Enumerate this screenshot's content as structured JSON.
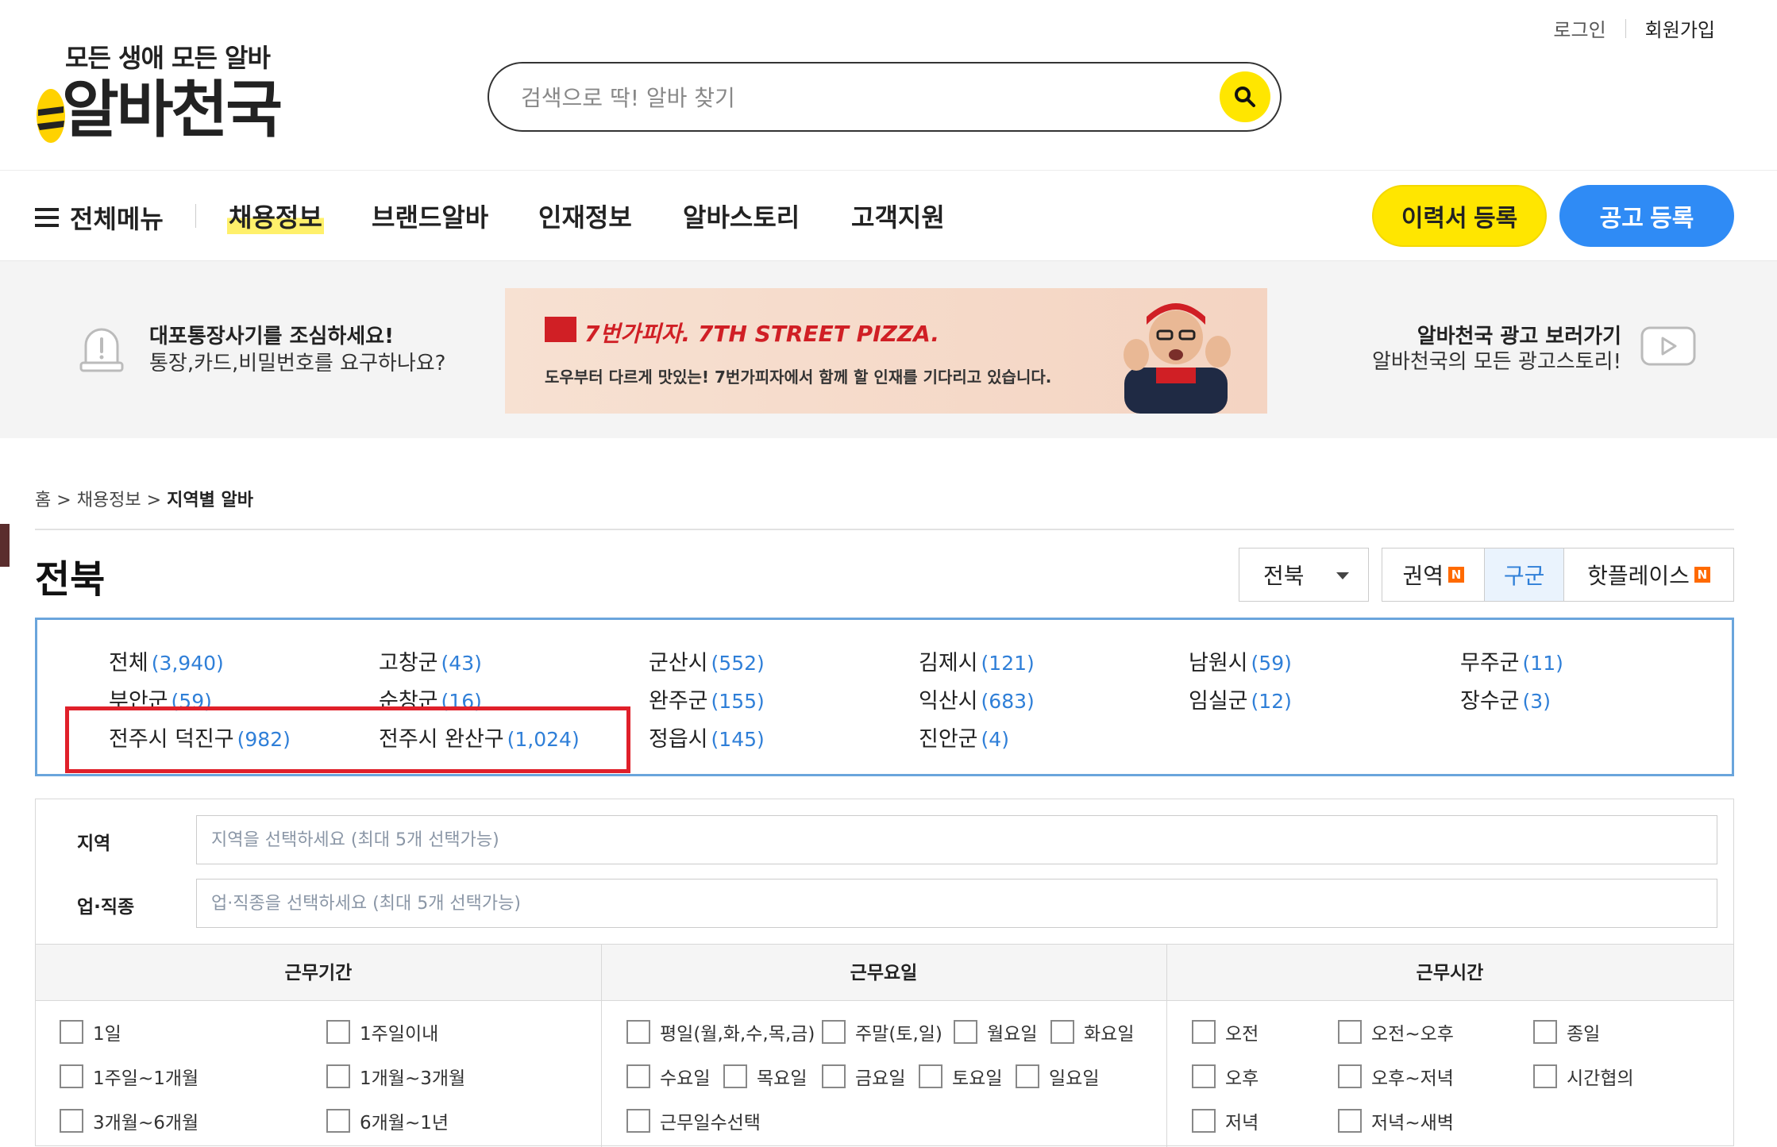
{
  "header": {
    "tagline": "모든 생애 모든 알바",
    "brand": "알바천국",
    "search_placeholder": "검색으로 딱! 알바 찾기",
    "login": "로그인",
    "join": "회원가입"
  },
  "nav": {
    "all_menu": "전체메뉴",
    "items": [
      "채용정보",
      "브랜드알바",
      "인재정보",
      "알바스토리",
      "고객지원"
    ],
    "resume_button": "이력서 등록",
    "post_button": "공고 등록"
  },
  "banner": {
    "warn_title": "대포통장사기를 조심하세요!",
    "warn_sub": "통장,카드,비밀번호를 요구하나요?",
    "ad_brand": "7번가피자. 7TH STREET PIZZA.",
    "ad_copy": "도우부터 다르게 맛있는! 7번가피자에서 함께 할 인재를 기다리고 있습니다.",
    "adlink_title": "알바천국 광고 보러가기",
    "adlink_sub": "알바천국의 모든 광고스토리!"
  },
  "breadcrumb": {
    "home": "홈",
    "sep": ">",
    "mid": "채용정보",
    "current": "지역별 알바"
  },
  "page_title": "전북",
  "region_select": "전북",
  "view_tabs": [
    {
      "label": "권역",
      "badge": "N"
    },
    {
      "label": "구군",
      "badge": ""
    },
    {
      "label": "핫플레이스",
      "badge": "N"
    }
  ],
  "regions": [
    {
      "name": "전체",
      "count": "(3,940)"
    },
    {
      "name": "고창군",
      "count": "(43)"
    },
    {
      "name": "군산시",
      "count": "(552)"
    },
    {
      "name": "김제시",
      "count": "(121)"
    },
    {
      "name": "남원시",
      "count": "(59)"
    },
    {
      "name": "무주군",
      "count": "(11)"
    },
    {
      "name": "부안군",
      "count": "(59)"
    },
    {
      "name": "순창군",
      "count": "(16)"
    },
    {
      "name": "완주군",
      "count": "(155)"
    },
    {
      "name": "익산시",
      "count": "(683)"
    },
    {
      "name": "임실군",
      "count": "(12)"
    },
    {
      "name": "장수군",
      "count": "(3)"
    },
    {
      "name": "전주시 덕진구",
      "count": "(982)"
    },
    {
      "name": "전주시 완산구",
      "count": "(1,024)"
    },
    {
      "name": "정읍시",
      "count": "(145)"
    },
    {
      "name": "진안군",
      "count": "(4)"
    }
  ],
  "filters": {
    "region_label": "지역",
    "region_placeholder": "지역을 선택하세요 (최대 5개 선택가능)",
    "job_label": "업·직종",
    "job_placeholder": "업·직종을 선택하세요 (최대 5개 선택가능)",
    "period_head": "근무기간",
    "days_head": "근무요일",
    "time_head": "근무시간",
    "period_options": [
      "1일",
      "1주일이내",
      "1주일~1개월",
      "1개월~3개월",
      "3개월~6개월",
      "6개월~1년"
    ],
    "days_options": [
      "평일(월,화,수,목,금)",
      "주말(토,일)",
      "월요일",
      "화요일",
      "수요일",
      "목요일",
      "금요일",
      "토요일",
      "일요일",
      "근무일수선택"
    ],
    "time_options": [
      "오전",
      "오전~오후",
      "종일",
      "오후",
      "오후~저녁",
      "시간협의",
      "저녁",
      "저녁~새벽"
    ]
  },
  "colors": {
    "accent_yellow": "#ffe600",
    "accent_blue": "#2f8bf5",
    "link_blue": "#2f7fd8",
    "highlight_red": "#e0202a"
  }
}
